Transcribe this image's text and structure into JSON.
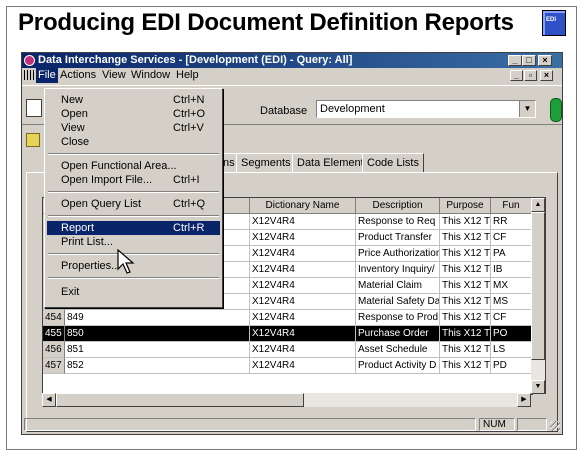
{
  "slide_title": "Producing EDI Document Definition Reports",
  "window": {
    "title": "Data Interchange Services - [Development (EDI) - Query: All]",
    "controls": [
      "_",
      "□",
      "×"
    ]
  },
  "menubar": [
    "File",
    "Actions",
    "View",
    "Window",
    "Help"
  ],
  "toolbar": {
    "database_label": "Database",
    "database_value": "Development"
  },
  "file_menu": [
    {
      "label": "New",
      "shortcut": "Ctrl+N"
    },
    {
      "label": "Open",
      "shortcut": "Ctrl+O"
    },
    {
      "label": "View",
      "shortcut": "Ctrl+V"
    },
    {
      "label": "Close",
      "shortcut": ""
    },
    {
      "label": "Open Functional Area...",
      "shortcut": ""
    },
    {
      "label": "Open Import File...",
      "shortcut": "Ctrl+I"
    },
    {
      "label": "Open Query List",
      "shortcut": "Ctrl+Q"
    },
    {
      "label": "Report",
      "shortcut": "Ctrl+R"
    },
    {
      "label": "Print List...",
      "shortcut": ""
    },
    {
      "label": "Properties...",
      "shortcut": ""
    },
    {
      "label": "Exit",
      "shortcut": ""
    }
  ],
  "tabs": [
    "ns",
    "Segments",
    "Data Elements",
    "Code Lists"
  ],
  "grid": {
    "headers": [
      "e",
      "Dictionary Name",
      "Description",
      "Purpose",
      "Fun"
    ],
    "rows": [
      {
        "id": "",
        "name": "",
        "dict": "X12V4R4",
        "desc": "Response to Req",
        "purpose": "This X12 Tr",
        "fun": "RR"
      },
      {
        "id": "",
        "name": "",
        "dict": "X12V4R4",
        "desc": "Product Transfer",
        "purpose": "This X12 Tr",
        "fun": "CF"
      },
      {
        "id": "",
        "name": "",
        "dict": "X12V4R4",
        "desc": "Price Authorization",
        "purpose": "This X12 Tr",
        "fun": "PA"
      },
      {
        "id": "",
        "name": "",
        "dict": "X12V4R4",
        "desc": "Inventory Inquiry/",
        "purpose": "This X12 Tr",
        "fun": "IB"
      },
      {
        "id": "",
        "name": "",
        "dict": "X12V4R4",
        "desc": "Material Claim",
        "purpose": "This X12 Tr",
        "fun": "MX"
      },
      {
        "id": "453",
        "name": "848",
        "dict": "X12V4R4",
        "desc": "Material Safety Da",
        "purpose": "This X12 Tr",
        "fun": "MS"
      },
      {
        "id": "454",
        "name": "849",
        "dict": "X12V4R4",
        "desc": "Response to Prod",
        "purpose": "This X12 Tr",
        "fun": "CF"
      },
      {
        "id": "455",
        "name": "850",
        "dict": "X12V4R4",
        "desc": "Purchase Order",
        "purpose": "This X12 Tr",
        "fun": "PO"
      },
      {
        "id": "456",
        "name": "851",
        "dict": "X12V4R4",
        "desc": "Asset Schedule",
        "purpose": "This X12 Tr",
        "fun": "LS"
      },
      {
        "id": "457",
        "name": "852",
        "dict": "X12V4R4",
        "desc": "Product Activity D",
        "purpose": "This X12 Tr",
        "fun": "PD"
      }
    ]
  },
  "statusbar": {
    "num": "NUM"
  },
  "colors": {
    "title_bar": "#0a246a",
    "selection": "#000000",
    "chrome": "#d4d0c8"
  }
}
